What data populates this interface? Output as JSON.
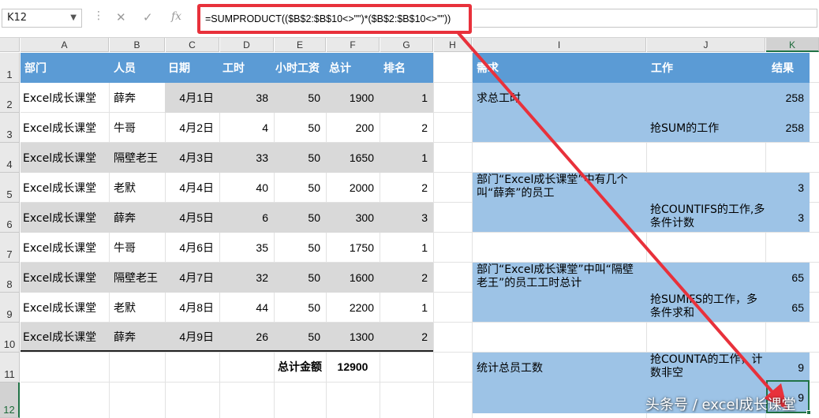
{
  "name_box": {
    "value": "K12",
    "dropdown_icon": "chevron-down-icon"
  },
  "formula_bar": {
    "cancel_icon": "✕",
    "enter_icon": "✓",
    "fx_label": "fx",
    "formula": "=SUMPRODUCT(($B$2:$B$10<>\"\")*($B$2:$B$10<>\"\"))"
  },
  "columns": [
    "A",
    "B",
    "C",
    "D",
    "E",
    "F",
    "G",
    "H",
    "I",
    "J",
    "K"
  ],
  "rows": [
    "1",
    "2",
    "3",
    "4",
    "5",
    "6",
    "7",
    "8",
    "9",
    "10",
    "11",
    "12"
  ],
  "table": {
    "headers": [
      "部门",
      "人员",
      "日期",
      "工时",
      "小时工资",
      "总计",
      "排名"
    ],
    "rows": [
      [
        "Excel成长课堂",
        "薛奔",
        "4月1日",
        "38",
        "50",
        "1900",
        "1"
      ],
      [
        "Excel成长课堂",
        "牛哥",
        "4月2日",
        "4",
        "50",
        "200",
        "2"
      ],
      [
        "Excel成长课堂",
        "隔壁老王",
        "4月3日",
        "33",
        "50",
        "1650",
        "1"
      ],
      [
        "Excel成长课堂",
        "老默",
        "4月4日",
        "40",
        "50",
        "2000",
        "2"
      ],
      [
        "Excel成长课堂",
        "薛奔",
        "4月5日",
        "6",
        "50",
        "300",
        "3"
      ],
      [
        "Excel成长课堂",
        "牛哥",
        "4月6日",
        "35",
        "50",
        "1750",
        "1"
      ],
      [
        "Excel成长课堂",
        "隔壁老王",
        "4月7日",
        "32",
        "50",
        "1600",
        "2"
      ],
      [
        "Excel成长课堂",
        "老默",
        "4月8日",
        "44",
        "50",
        "2200",
        "1"
      ],
      [
        "Excel成长课堂",
        "薛奔",
        "4月9日",
        "26",
        "50",
        "1300",
        "2"
      ]
    ],
    "total_label": "总计金额",
    "total_value": "12900"
  },
  "right_table": {
    "headers": [
      "需求",
      "工作",
      "结果"
    ],
    "groups": [
      {
        "need": "求总工时",
        "work1": "",
        "result1": "258",
        "work2": "抢SUM的工作",
        "result2": "258"
      },
      {
        "need": "部门“Excel成长课堂”中有几个叫“薛奔”的员工",
        "work1": "",
        "result1": "3",
        "work2": "抢COUNTIFS的工作,多条件计数",
        "result2": "3"
      },
      {
        "need": "部门“Excel成长课堂”中叫“隔壁老王”的员工工时总计",
        "work1": "",
        "result1": "65",
        "work2": "抢SUMIFS的工作，多条件求和",
        "result2": "65"
      },
      {
        "need": "统计总员工数",
        "work1": "抢COUNTA的工作，计数非空",
        "result1": "9",
        "work2": "",
        "result2": "9"
      }
    ]
  },
  "colors": {
    "header_blue": "#5b9bd5",
    "band_gray": "#d9d9d9",
    "light_blue": "#9dc3e6",
    "annotation_red": "#e8313b",
    "excel_green": "#217346"
  },
  "watermark": "头条号 / excel成长课堂"
}
